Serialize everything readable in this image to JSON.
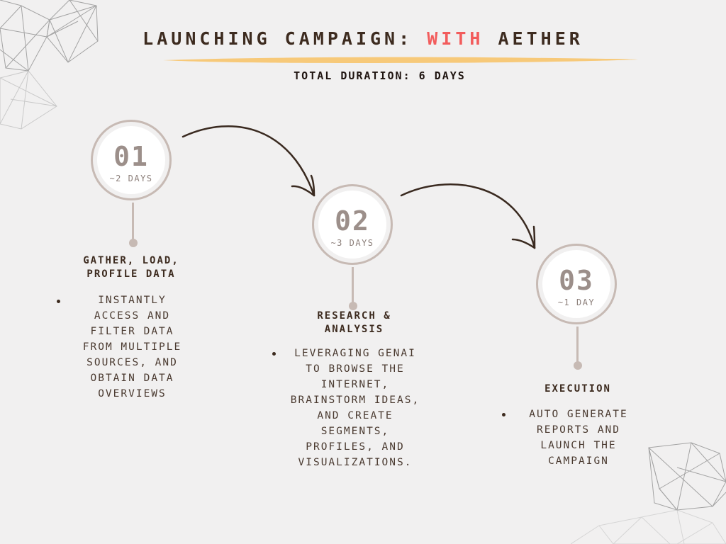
{
  "header": {
    "title_part1": "LAUNCHING CAMPAIGN:",
    "title_accent": "WITH",
    "title_part2": "AETHER",
    "subtitle": "TOTAL DURATION: 6 DAYS"
  },
  "colors": {
    "background": "#f1f0f0",
    "text": "#3d2b1f",
    "accent": "#f25c5c",
    "underline": "#f7c46c",
    "circle": "#c7bab4"
  },
  "steps": [
    {
      "number": "01",
      "duration": "~2 DAYS",
      "title": "GATHER, LOAD, PROFILE DATA",
      "bullets": [
        "INSTANTLY ACCESS AND FILTER DATA FROM MULTIPLE SOURCES, AND OBTAIN DATA OVERVIEWS"
      ]
    },
    {
      "number": "02",
      "duration": "~3 DAYS",
      "title": "RESEARCH & ANALYSIS",
      "bullets": [
        "LEVERAGING GENAI TO BROWSE THE INTERNET, BRAINSTORM IDEAS, AND CREATE SEGMENTS, PROFILES, AND VISUALIZATIONS."
      ]
    },
    {
      "number": "03",
      "duration": "~1 DAY",
      "title": "EXECUTION",
      "bullets": [
        "AUTO GENERATE REPORTS AND LAUNCH THE CAMPAIGN"
      ]
    }
  ],
  "decorations": {
    "arrow_1": "curved-arrow-icon",
    "arrow_2": "curved-arrow-icon",
    "corner_top_left": "geometric-mesh-icon",
    "corner_bottom_right": "geometric-mesh-icon"
  }
}
